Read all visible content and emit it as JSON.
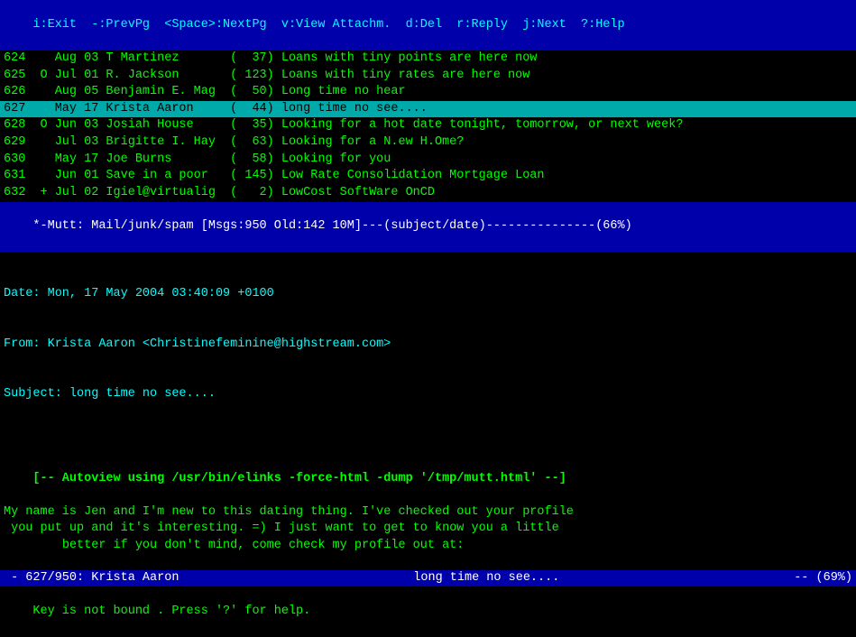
{
  "topbar": {
    "label": "i:Exit  -:PrevPg  <Space>:NextPg  v:View Attachm.  d:Del  r:Reply  j:Next  ?:Help"
  },
  "emailList": [
    {
      "id": "624",
      "marker": " ",
      "date": "Aug 03",
      "from": "T Martinez",
      "size": "  37",
      "subject": "Loans with tiny points are here now",
      "selected": false,
      "new": false
    },
    {
      "id": "625",
      "marker": "O",
      "date": "Jul 01",
      "from": "R. Jackson",
      "size": " 123",
      "subject": "Loans with tiny rates are here now",
      "selected": false,
      "new": false
    },
    {
      "id": "626",
      "marker": " ",
      "date": "Aug 05",
      "from": "Benjamin E. Mag",
      "size": "  50",
      "subject": "Long time no hear",
      "selected": false,
      "new": false
    },
    {
      "id": "627",
      "marker": " ",
      "date": "May 17",
      "from": "Krista Aaron",
      "size": "  44",
      "subject": "long time no see....",
      "selected": true,
      "new": false
    },
    {
      "id": "628",
      "marker": "O",
      "date": "Jun 03",
      "from": "Josiah House",
      "size": "  35",
      "subject": "Looking for a hot date tonight, tomorrow, or next week?",
      "selected": false,
      "new": false
    },
    {
      "id": "629",
      "marker": " ",
      "date": "Jul 03",
      "from": "Brigitte I. Hay",
      "size": "  63",
      "subject": "Looking for a N.ew H.Ome?",
      "selected": false,
      "new": false
    },
    {
      "id": "630",
      "marker": " ",
      "date": "May 17",
      "from": "Joe Burns",
      "size": "  58",
      "subject": "Looking for you",
      "selected": false,
      "new": false
    },
    {
      "id": "631",
      "marker": " ",
      "date": "Jun 01",
      "from": "Save in a poor",
      "size": " 145",
      "subject": "Low Rate Consolidation Mortgage Loan",
      "selected": false,
      "new": false
    },
    {
      "id": "632",
      "marker": "+",
      "date": "Jul 02",
      "from": "Igiel@virtualig",
      "size": "   2",
      "subject": "LowCost SoftWare OnCD",
      "selected": false,
      "new": false
    }
  ],
  "statusBar": {
    "label": "*-Mutt: Mail/junk/spam [Msgs:950 Old:142 10M]---(subject/date)---------------(66%)"
  },
  "emailHeader": {
    "date": "Date: Mon, 17 May 2004 03:40:09 +0100",
    "from": "From: Krista Aaron <Christinefeminine@highstream.com>",
    "subject": "Subject: long time no see...."
  },
  "autoviewLine": "[-- Autoview using /usr/bin/elinks -force-html -dump '/tmp/mutt.html' --]",
  "emailBody": "My name is Jen and I'm new to this dating thing. I've checked out your profile\n you put up and it's interesting. =) I just want to get to know you a little\n        better if you don't mind, come check my profile out at:\n\n                        www.live.jen.com/chat.html\n\nI also got a webcam so we can make it interesting, anyways hope you get back to\n                                   me.\n                                 bye :)\n\n                    gxsnkxxgnduvyjwyceudc,jobxs\n                       zcozccrociesbehgbpow\n                    rnxlfu,jnqpblipdkgwwyqofracsz\n                   xmqawbxsb,jrppoibvlpfhqowldtp\n                     bixhghvrxtqgfeoqcofzycb\n                     hugzffaffulsklpzhrfxbtt\n                     btpztlfotqmmoaiwlosqv",
  "bottomStatus": {
    "left": " - 627/950: Krista Aaron",
    "center": "long time no see....",
    "right": "-- (69%)"
  },
  "bottomBar": {
    "label": "Key is not bound . Press '?' for help."
  }
}
